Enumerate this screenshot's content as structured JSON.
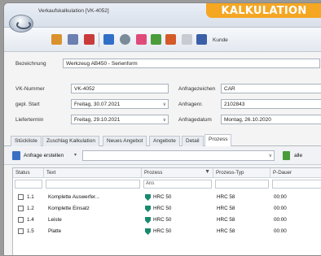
{
  "window": {
    "title": "Verkaufskalkulation [VK-4052]"
  },
  "banner": {
    "label": "KALKULATION"
  },
  "toolbar": {
    "kunde_label": "Kunde"
  },
  "form": {
    "bezeichnung_label": "Bezeichnung",
    "bezeichnung_value": "Werkzeug AB450 - Serienform",
    "vknummer_label": "VK-Nummer",
    "vknummer_value": "VK-4052",
    "gepl_start_label": "gepl. Start",
    "gepl_start_value": "Freitag, 30.07.2021",
    "liefertermin_label": "Liefertermin",
    "liefertermin_value": "Freitag, 29.10.2021",
    "anfragezeichen_label": "Anfragezeichen",
    "anfragezeichen_value": "CAR",
    "anfragenr_label": "Anfragenr.",
    "anfragenr_value": "2102843",
    "anfragedatum_label": "Anfragedatum",
    "anfragedatum_value": "Montag, 26.10.2020"
  },
  "tabs": [
    "Stückliste",
    "Zuschlag Kalkulation",
    "Neues Angebot",
    "Angebote",
    "Detail",
    "Prozess"
  ],
  "subbar": {
    "create_label": "Anfrage erstellen",
    "alle_label": "alle"
  },
  "grid": {
    "headers": [
      "Status",
      "Text",
      "Prozess",
      "Prozess-Typ",
      "P-Dauer"
    ],
    "filter_placeholder": "Ans",
    "rows": [
      {
        "num": "1.1",
        "text": "Komplette Auswerfer...",
        "prozess": "HRC 50",
        "typ": "HRC 58",
        "dauer": "00:00"
      },
      {
        "num": "1.2",
        "text": "Komplette Einsatz",
        "prozess": "HRC 50",
        "typ": "HRC 58",
        "dauer": "00:00"
      },
      {
        "num": "1.4",
        "text": "Leiste",
        "prozess": "HRC 50",
        "typ": "HRC 58",
        "dauer": "00:00"
      },
      {
        "num": "1.5",
        "text": "Platte",
        "prozess": "HRC 50",
        "typ": "HRC 58",
        "dauer": "00:00"
      }
    ]
  },
  "colors": {
    "accent": "#f5a623",
    "shield": "#1a8a6e"
  }
}
